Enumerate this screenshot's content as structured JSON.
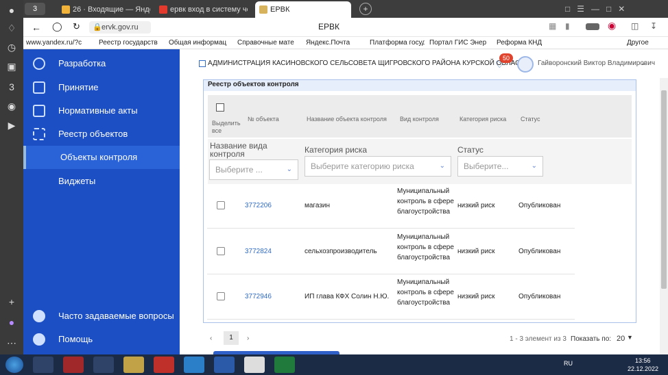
{
  "browser": {
    "tabs": [
      {
        "label": "26 · Входящие — Яндекс.П"
      },
      {
        "label": "ервк вход в систему чере"
      },
      {
        "label": "ЕРВК"
      }
    ],
    "tab_counter": "3",
    "address": "ervk.gov.ru",
    "page_title": "ЕРВК",
    "bookmarks": [
      "www.yandex.ru/?c",
      "Реестр государств",
      "Общая информац",
      "Справочные мате",
      "Яндекс.Почта",
      "Платформа госуд",
      "Портал ГИС Энер",
      "Реформа КНД"
    ],
    "bookmarks_more": "Другое"
  },
  "nav": {
    "items": [
      {
        "label": "Разработка"
      },
      {
        "label": "Принятие"
      },
      {
        "label": "Нормативные акты"
      },
      {
        "label": "Реестр объектов"
      },
      {
        "label": "Объекты контроля"
      },
      {
        "label": "Виджеты"
      }
    ],
    "faq": "Часто задаваемые вопросы",
    "help": "Помощь"
  },
  "header": {
    "org": "АДМИНИСТРАЦИЯ КАСИНОВСКОГО СЕЛЬСОВЕТА ЩИГРОВСКОГО РАЙОНА КУРСКОЙ ОБЛАСТИ",
    "notifications": "50",
    "user": "Гайворонский Виктор Владимирович"
  },
  "panel": {
    "title": "Реестр объектов контроля",
    "select_all": "Выделить все",
    "columns": [
      "№ объекта",
      "Название объекта контроля",
      "Вид контроля",
      "Категория риска",
      "Статус"
    ],
    "filters": {
      "type_label": "Название вида контроля",
      "type_placeholder": "Выберите ...",
      "risk_label": "Категория риска",
      "risk_placeholder": "Выберите категорию риска",
      "status_label": "Статус",
      "status_placeholder": "Выберите..."
    },
    "rows": [
      {
        "id": "3772206",
        "name": "магазин",
        "kind": "Муниципальный контроль в сфере благоустройства",
        "risk": "низкий риск",
        "status": "Опубликован"
      },
      {
        "id": "3772824",
        "name": "сельхозпроизводитель",
        "kind": "Муниципальный контроль в сфере благоустройства",
        "risk": "низкий риск",
        "status": "Опубликован"
      },
      {
        "id": "3772946",
        "name": "ИП глава КФХ Солин Н.Ю.",
        "kind": "Муниципальный контроль в сфере благоустройства",
        "risk": "низкий риск",
        "status": "Опубликован"
      }
    ]
  },
  "pagination": {
    "page": "1",
    "summary": "1 - 3 элемент из 3",
    "show_label": "Показать по:",
    "page_size": "20"
  },
  "taskbar": {
    "lang": "RU",
    "time": "13:56",
    "date": "22.12.2022"
  }
}
